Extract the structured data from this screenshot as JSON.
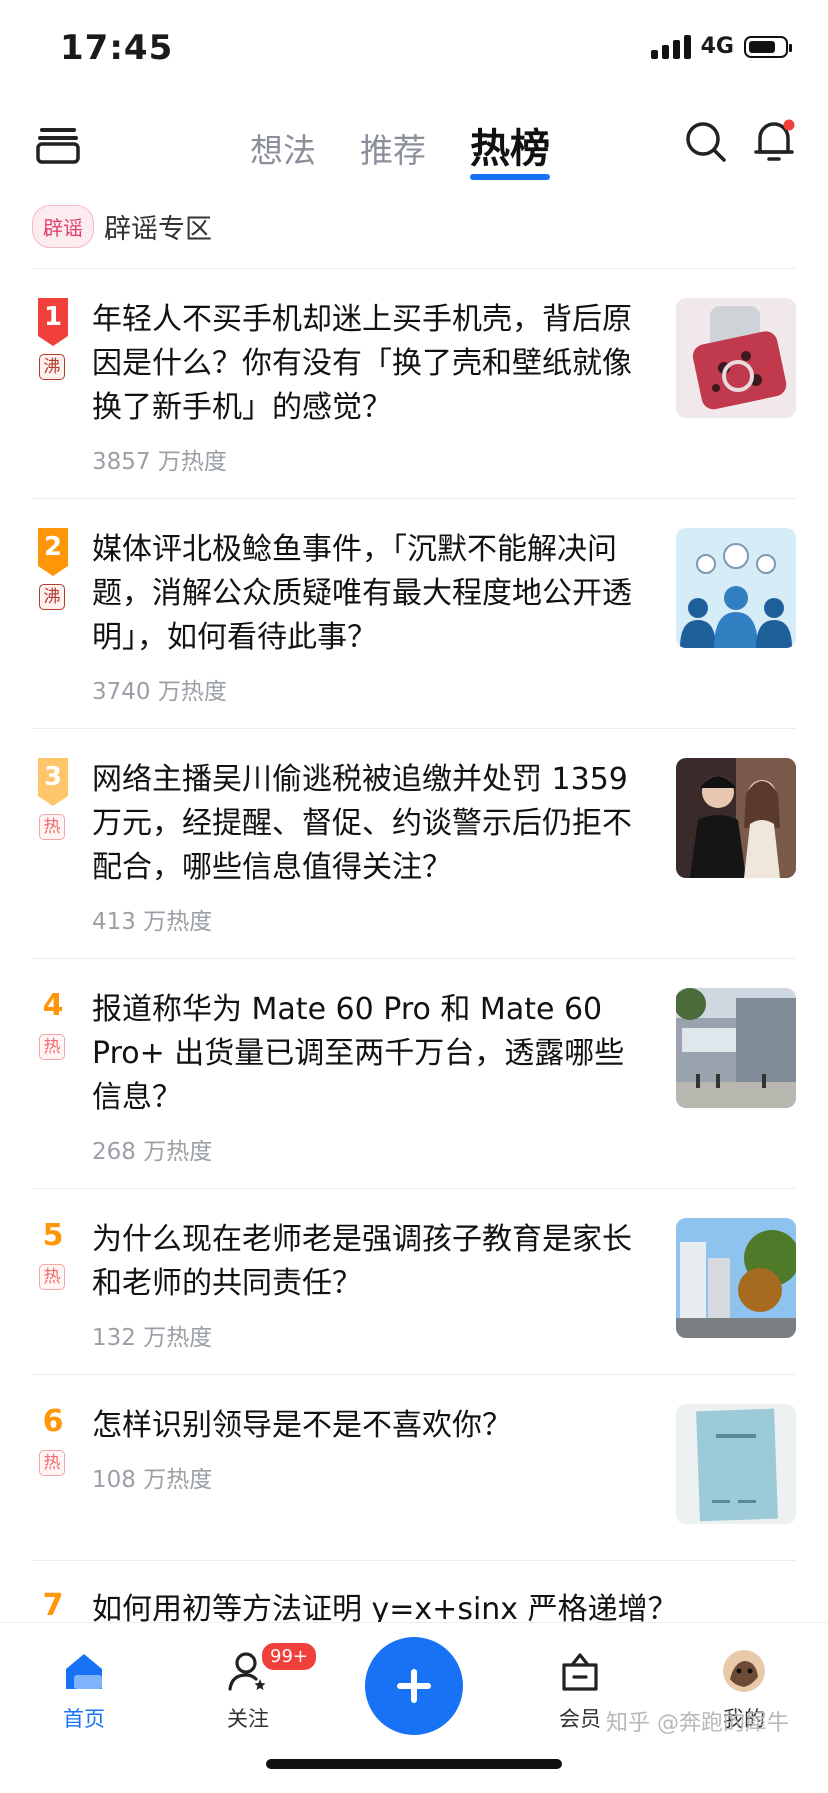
{
  "status_bar": {
    "time": "17:45",
    "network": "4G",
    "battery_level": 0.75
  },
  "top_nav": {
    "tabs": [
      {
        "label": "想法",
        "active": false
      },
      {
        "label": "推荐",
        "active": false
      },
      {
        "label": "热榜",
        "active": true
      }
    ],
    "icons": [
      "menu-icon",
      "search-icon",
      "bell-icon"
    ]
  },
  "rumor_section": {
    "badge": "辟谣",
    "label": "辟谣专区"
  },
  "hot_list": [
    {
      "rank": "1",
      "tag": "沸",
      "title": "年轻人不买手机却迷上买手机壳，背后原因是什么？你有没有「换了壳和壁纸就像换了新手机」的感觉？",
      "heat": "3857 万热度",
      "thumb": "phone-case-image"
    },
    {
      "rank": "2",
      "tag": "沸",
      "title": "媒体评北极鲶鱼事件，「沉默不能解决问题，消解公众质疑唯有最大程度地公开透明」，如何看待此事？",
      "heat": "3740 万热度",
      "thumb": "lightbulb-people-image"
    },
    {
      "rank": "3",
      "tag": "热",
      "title": "网络主播吴川偷逃税被追缴并处罚 1359 万元，经提醒、督促、约谈警示后仍拒不配合，哪些信息值得关注？",
      "heat": "413 万热度",
      "thumb": "stage-people-image"
    },
    {
      "rank": "4",
      "tag": "热",
      "title": "报道称华为 Mate 60 Pro 和 Mate 60 Pro+ 出货量已调至两千万台，透露哪些信息？",
      "heat": "268 万热度",
      "thumb": "store-building-image"
    },
    {
      "rank": "5",
      "tag": "热",
      "title": "为什么现在老师老是强调孩子教育是家长和老师的共同责任？",
      "heat": "132 万热度",
      "thumb": "city-trees-image"
    },
    {
      "rank": "6",
      "tag": "热",
      "title": "怎样识别领导是不是不喜欢你？",
      "heat": "108 万热度",
      "thumb": "document-image"
    },
    {
      "rank": "7",
      "title": "如何用初等方法证明 y=x+sinx 严格递增？"
    }
  ],
  "bottom_nav": {
    "items": [
      {
        "label": "首页",
        "icon": "home-icon",
        "active": true
      },
      {
        "label": "关注",
        "icon": "follow-icon",
        "badge": "99+"
      },
      {
        "label": "会员",
        "icon": "vip-bag-icon"
      },
      {
        "label": "我的",
        "icon": "avatar-icon"
      }
    ],
    "fab_icon": "plus-icon",
    "watermark": "知乎 @奔跑的犀牛"
  },
  "colors": {
    "accent": "#1772f6",
    "rank1": "#f1403c",
    "rank2": "#ff9607",
    "rank3": "#ffc56a",
    "boil_tag": "#b23a2f",
    "hot_tag": "#f26a6a"
  }
}
